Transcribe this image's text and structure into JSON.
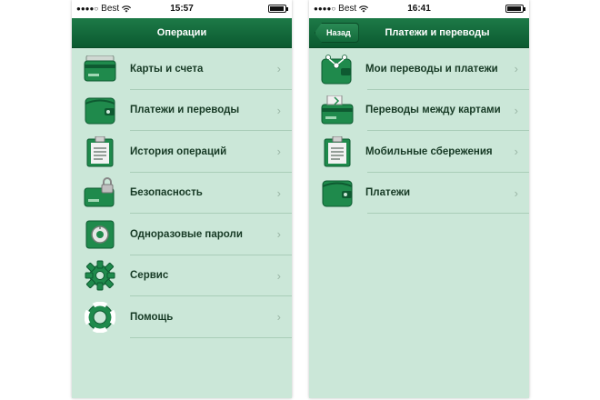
{
  "left": {
    "status": {
      "carrier": "Best",
      "time": "15:57"
    },
    "nav_title": "Операции",
    "items": [
      {
        "label": "Карты и счета",
        "icon": "cards-icon"
      },
      {
        "label": "Платежи и переводы",
        "icon": "wallet-icon"
      },
      {
        "label": "История операций",
        "icon": "clipboard-icon"
      },
      {
        "label": "Безопасность",
        "icon": "card-lock-icon"
      },
      {
        "label": "Одноразовые пароли",
        "icon": "safe-icon"
      },
      {
        "label": "Сервис",
        "icon": "gear-icon"
      },
      {
        "label": "Помощь",
        "icon": "lifebuoy-icon"
      }
    ]
  },
  "right": {
    "status": {
      "carrier": "Best",
      "time": "16:41"
    },
    "back_label": "Назад",
    "nav_title": "Платежи и переводы",
    "items": [
      {
        "label": "Мои переводы и платежи",
        "icon": "transfer-icon"
      },
      {
        "label": "Переводы между картами",
        "icon": "card-transfer-icon"
      },
      {
        "label": "Мобильные сбережения",
        "icon": "clipboard-icon"
      },
      {
        "label": "Платежи",
        "icon": "wallet-icon"
      }
    ]
  },
  "colors": {
    "nav_green": "#0b5a30",
    "list_bg": "#cbe7d8",
    "text": "#173a25",
    "icon_green": "#1f8a4c"
  }
}
